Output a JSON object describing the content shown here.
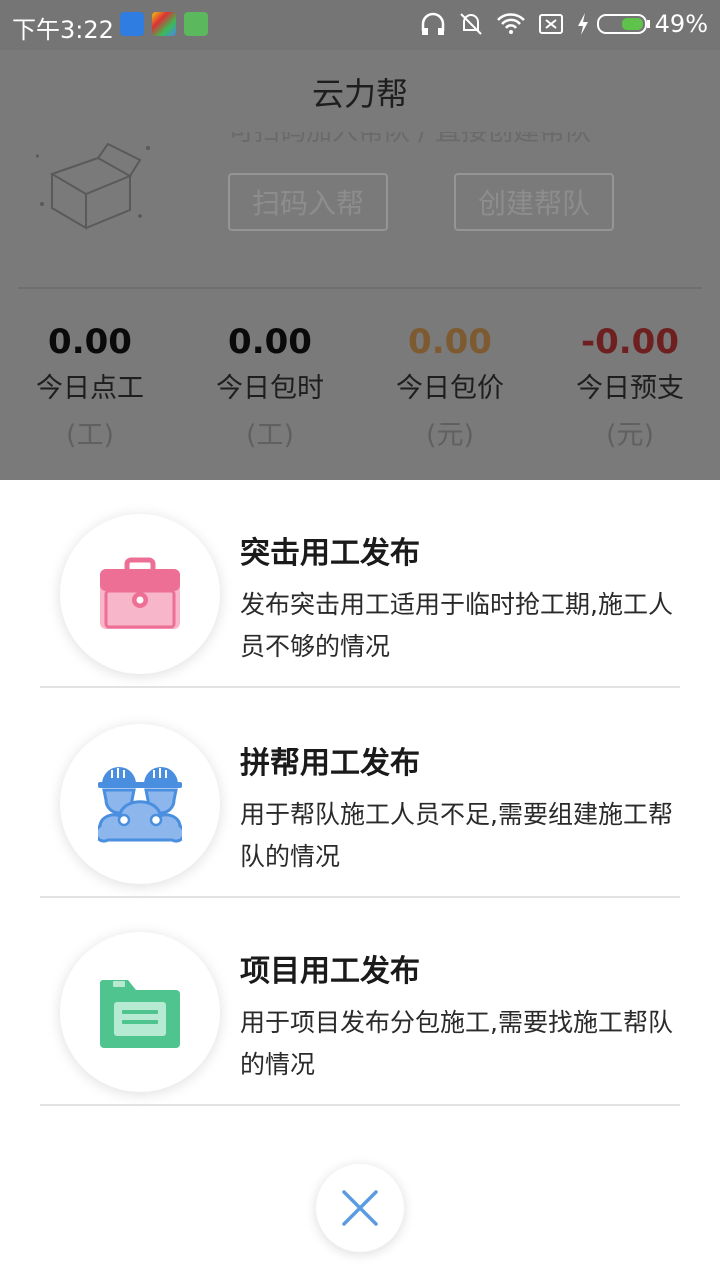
{
  "status_bar": {
    "time": "下午3:22",
    "battery": "49%"
  },
  "header": {
    "title": "云力帮"
  },
  "hint_text": "可扫码加入帮队 / 直接创建帮队",
  "buttons": {
    "scan_join": "扫码入帮",
    "create_team": "创建帮队"
  },
  "stats": [
    {
      "value": "0.00",
      "label": "今日点工",
      "unit": "(工)",
      "color": "#0a0a0a"
    },
    {
      "value": "0.00",
      "label": "今日包时",
      "unit": "(工)",
      "color": "#0a0a0a"
    },
    {
      "value": "0.00",
      "label": "今日包价",
      "unit": "(元)",
      "color": "#7d5a2f"
    },
    {
      "value": "-0.00",
      "label": "今日预支",
      "unit": "(元)",
      "color": "#6e1f1f"
    }
  ],
  "options": [
    {
      "title": "突击用工发布",
      "desc": "发布突击用工适用于临时抢工期,施工人员不够的情况",
      "icon": "toolbox-icon",
      "color": "#ee6f96"
    },
    {
      "title": "拼帮用工发布",
      "desc": "用于帮队施工人员不足,需要组建施工帮队的情况",
      "icon": "workers-helmet-icon",
      "color": "#4a8ee0"
    },
    {
      "title": "项目用工发布",
      "desc": "用于项目发布分包施工,需要找施工帮队的情况",
      "icon": "folder-icon",
      "color": "#4fc48e"
    }
  ],
  "close": {
    "icon": "close-icon",
    "color": "#5b9be0"
  }
}
